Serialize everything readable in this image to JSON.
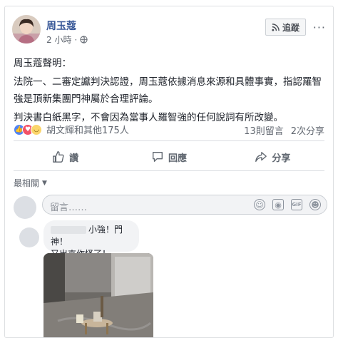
{
  "post": {
    "author": "周玉蔻",
    "time": "2 小時",
    "follow_label": "追蹤",
    "more": "···",
    "text_lines": [
      "周玉蔻聲明：",
      "法院一、二審定讞判決認證，周玉蔻依據消息來源和具體事實，指認羅智強是頂新集團門神屬於合理評論。",
      "判決書白紙黑字，不會因為當事人羅智強的任何說詞有所改變。"
    ],
    "reactions_text": "胡文輝和其他175人",
    "comments_count": "13則留言",
    "shares_count": "2次分享"
  },
  "actions": {
    "like": "讚",
    "comment": "回應",
    "share": "分享"
  },
  "comments": {
    "sort_label": "最相關",
    "placeholder": "留言……",
    "reply_line1": "小強！門神！",
    "reply_line2": "又出來作怪了！"
  },
  "icons": [
    "globe-icon",
    "rss-icon",
    "like-icon",
    "comment-icon",
    "share-icon",
    "emoji-icon",
    "camera-icon",
    "gif-icon",
    "sticker-icon"
  ],
  "colors": {
    "link": "#385898",
    "muted": "#616770",
    "like": "#4f84f6",
    "love": "#f25268",
    "haha": "#fbd56b"
  }
}
